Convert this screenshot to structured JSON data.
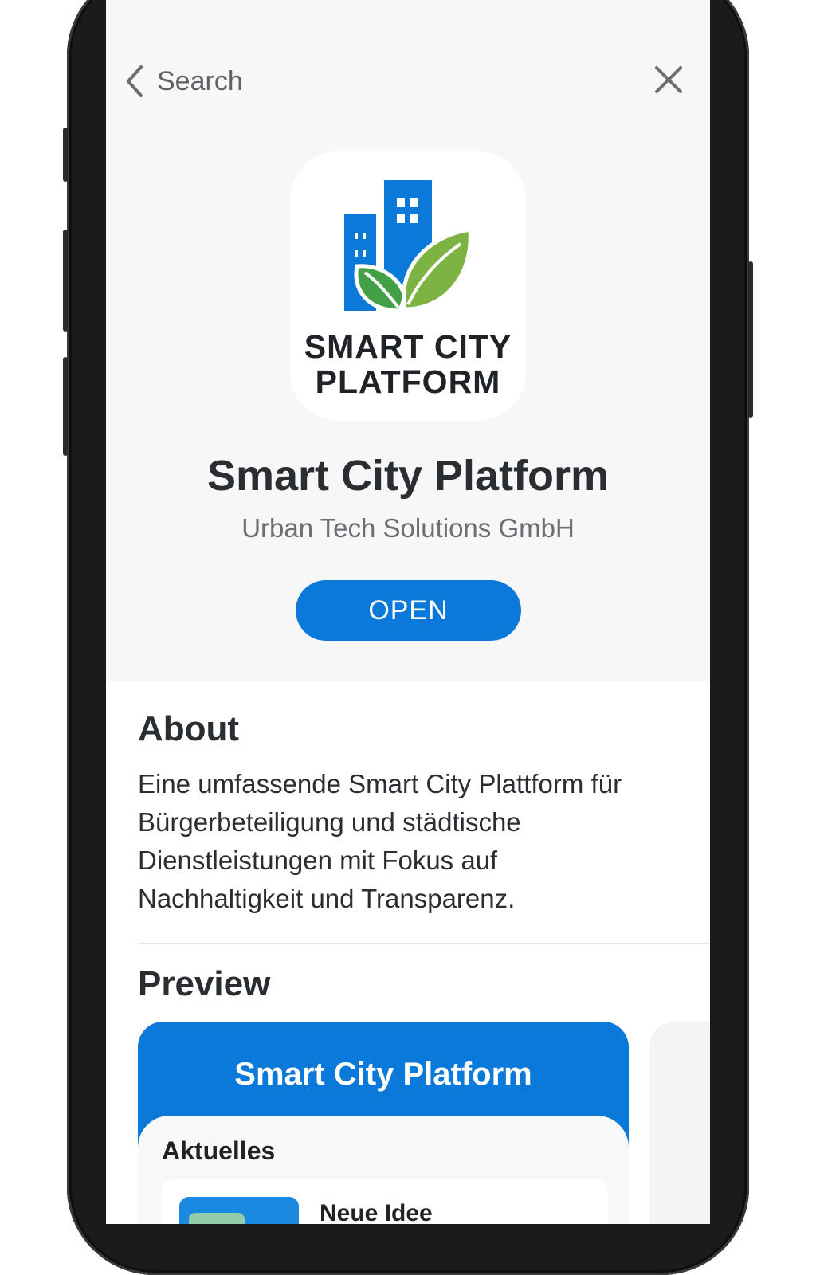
{
  "nav": {
    "back_label": "Search"
  },
  "app": {
    "icon_line1": "SMART CITY",
    "icon_line2": "PLATFORM",
    "name": "Smart City Platform",
    "developer": "Urban Tech Solutions GmbH",
    "action_label": "OPEN"
  },
  "about": {
    "heading": "About",
    "text": "Eine umfassende Smart City Plattform für Bürgerbeteiligung und städtische Dienstleistungen mit Fokus auf Nachhaltigkeit und Transparenz."
  },
  "preview": {
    "heading": "Preview",
    "card_title": "Smart City Platform",
    "section_label": "Aktuelles",
    "item_title": "Neue Idee"
  },
  "colors": {
    "accent": "#0a79d9",
    "leaf_light": "#7cb342",
    "leaf_dark": "#43a047"
  },
  "icons": [
    "chevron-left-icon",
    "close-icon",
    "city-logo-icon"
  ]
}
